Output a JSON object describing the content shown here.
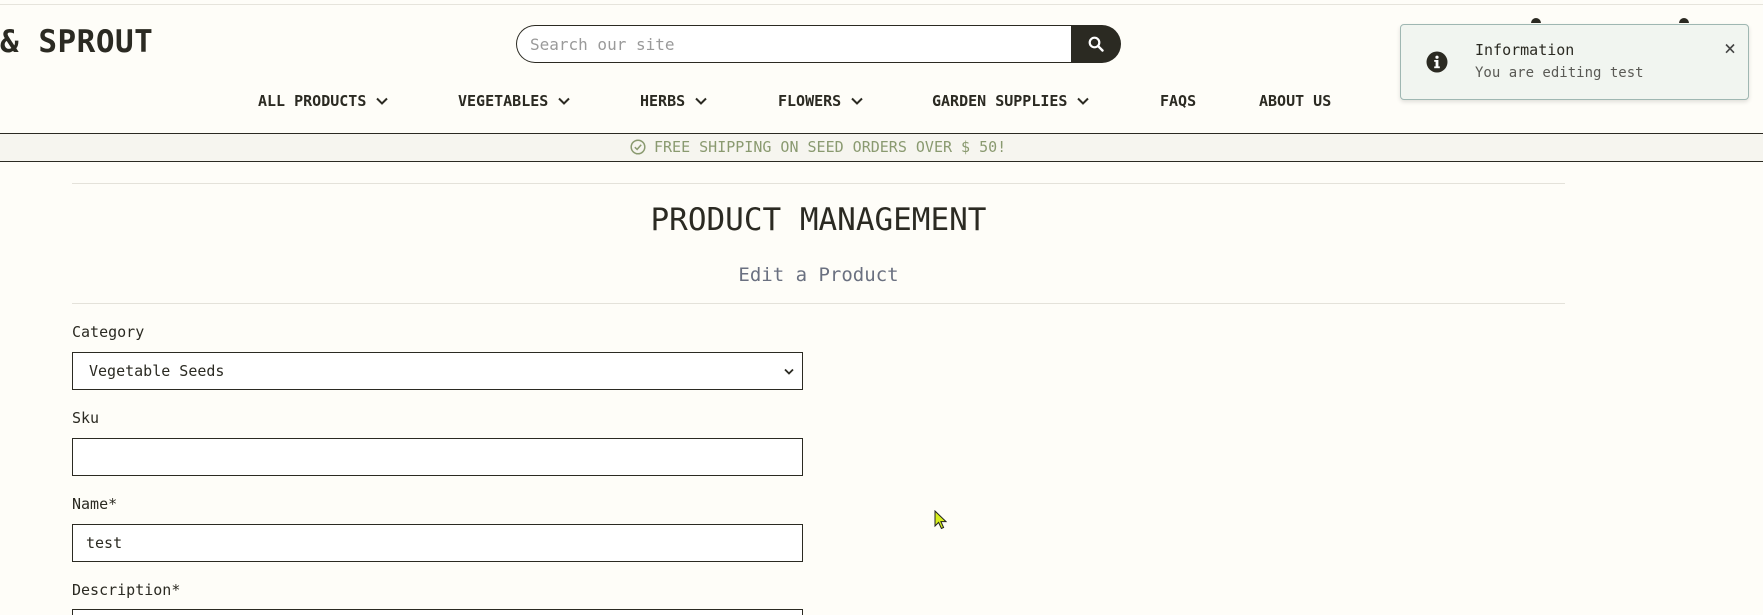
{
  "header": {
    "logo_text": "& SPROUT",
    "search": {
      "placeholder": "Search our site",
      "value": ""
    }
  },
  "nav": {
    "items": [
      {
        "label": "ALL PRODUCTS",
        "has_dropdown": true
      },
      {
        "label": "VEGETABLES",
        "has_dropdown": true
      },
      {
        "label": "HERBS",
        "has_dropdown": true
      },
      {
        "label": "FLOWERS",
        "has_dropdown": true
      },
      {
        "label": "GARDEN SUPPLIES",
        "has_dropdown": true
      },
      {
        "label": "FAQS",
        "has_dropdown": false
      },
      {
        "label": "ABOUT US",
        "has_dropdown": false
      }
    ]
  },
  "banner": {
    "text": "FREE SHIPPING ON SEED ORDERS OVER $ 50!",
    "icon": "check-circle-icon"
  },
  "main": {
    "title": "PRODUCT MANAGEMENT",
    "subtitle": "Edit a Product",
    "form": {
      "category": {
        "label": "Category",
        "value": "Vegetable Seeds"
      },
      "sku": {
        "label": "Sku",
        "value": ""
      },
      "name": {
        "label": "Name*",
        "value": "test"
      },
      "description": {
        "label": "Description*"
      }
    }
  },
  "toast": {
    "title": "Information",
    "message": "You are editing test",
    "icon": "info-icon",
    "close": "×"
  },
  "colors": {
    "dark": "#2b2a22",
    "background": "#fefdf8",
    "banner_text": "#8a9a70",
    "toast_border": "#9fb7b2",
    "subtitle": "#6a7080"
  }
}
